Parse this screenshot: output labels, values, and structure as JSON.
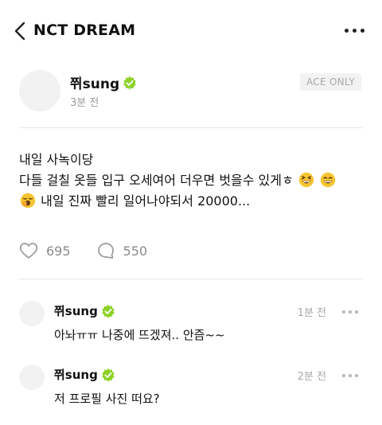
{
  "header": {
    "title": "NCT DREAM",
    "back_icon": "chevron-left-icon",
    "more_icon": "more-horizontal-icon"
  },
  "post": {
    "author": "쮜sung",
    "time": "3분 전",
    "badge": "ACE ONLY",
    "lines": {
      "line1": "내일 사녹이당",
      "line2": "다들 걸칠 옷들 입구 오세여어 더우면 벗을수 있게ㅎ",
      "line3": "내일 진짜 빨리 일어나야되서 20000..."
    },
    "emojis": [
      "grinning-squinting-face",
      "grinning-face-with-smiling-eyes",
      "yawning-face"
    ],
    "likes": "695",
    "comments": "550"
  },
  "comments": [
    {
      "author": "쮜sung",
      "time": "1분 전",
      "text": "아놔ㅠㅠ 나중에 뜨겠져..  안즘~~"
    },
    {
      "author": "쮜sung",
      "time": "2분 전",
      "text": "저 프로필 사진 떠요?"
    }
  ],
  "colors": {
    "verified": "#8ed129",
    "muted": "#9a9a9a",
    "divider": "#e6e6e6",
    "emoji": "#f7c531"
  }
}
